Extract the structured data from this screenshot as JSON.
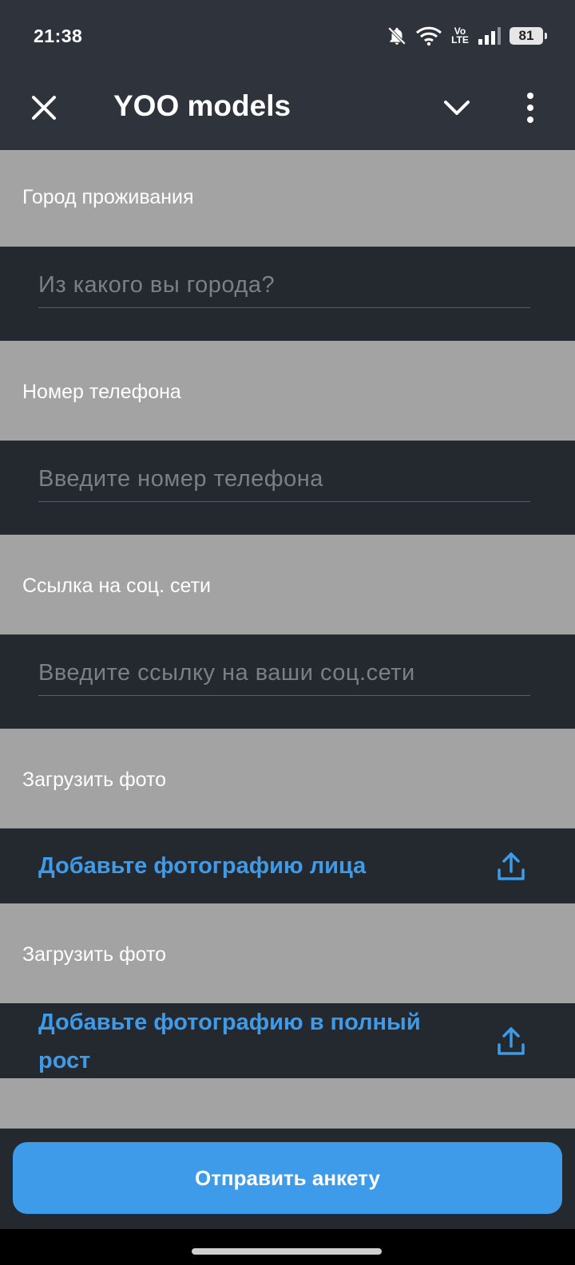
{
  "status_bar": {
    "time": "21:38",
    "icons": [
      "bell-off-icon",
      "wifi-icon",
      "volte-icon",
      "signal-icon",
      "battery-icon"
    ],
    "volte_top": "Vo",
    "volte_bottom": "LTE",
    "battery": "81"
  },
  "app_bar": {
    "title": "YOO models",
    "close_icon": "close-icon",
    "collapse_icon": "chevron-down-icon",
    "menu_icon": "more-vertical-icon"
  },
  "form": {
    "city_label": "Город проживания",
    "city_placeholder": "Из какого вы города?",
    "city_value": "",
    "phone_label": "Номер телефона",
    "phone_placeholder": "Введите номер телефона",
    "phone_value": "",
    "social_label": "Ссылка на соц. сети",
    "social_placeholder": "Введите ссылку на ваши соц.сети",
    "social_value": "",
    "photo1_label": "Загрузить фото",
    "photo1_action": "Добавьте фотографию лица",
    "photo2_label": "Загрузить фото",
    "photo2_action": "Добавьте фотографию в полный рост",
    "upload_icon": "upload-icon"
  },
  "submit": {
    "label": "Отправить анкету"
  },
  "colors": {
    "accent": "#3d9be9",
    "dark_bg": "#24282f",
    "bar_bg": "#2f343c",
    "label_bg": "#a3a3a3"
  }
}
